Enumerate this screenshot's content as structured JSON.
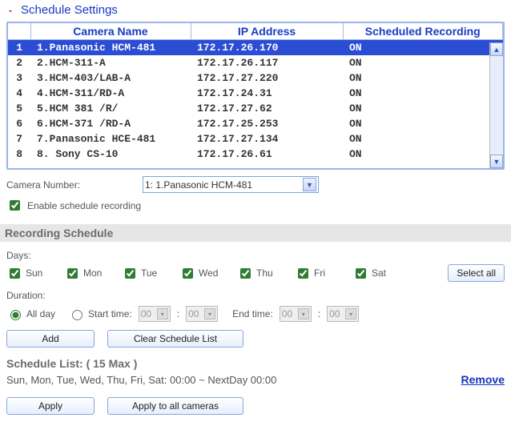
{
  "page": {
    "title": "Schedule Settings",
    "toggle_icon": "-"
  },
  "table": {
    "headers": {
      "index": "",
      "name": "Camera Name",
      "ip": "IP Address",
      "rec": "Scheduled Recording"
    },
    "rows": [
      {
        "idx": "1",
        "name": "1.Panasonic HCM-481",
        "ip": "172.17.26.170",
        "rec": "ON",
        "selected": true
      },
      {
        "idx": "2",
        "name": "2.HCM-311-A",
        "ip": "172.17.26.117",
        "rec": "ON",
        "selected": false
      },
      {
        "idx": "3",
        "name": "3.HCM-403/LAB-A",
        "ip": "172.17.27.220",
        "rec": "ON",
        "selected": false
      },
      {
        "idx": "4",
        "name": "4.HCM-311/RD-A",
        "ip": "172.17.24.31",
        "rec": "ON",
        "selected": false
      },
      {
        "idx": "5",
        "name": "5.HCM 381 /R/",
        "ip": "172.17.27.62",
        "rec": "ON",
        "selected": false
      },
      {
        "idx": "6",
        "name": "6.HCM-371 /RD-A",
        "ip": "172.17.25.253",
        "rec": "ON",
        "selected": false
      },
      {
        "idx": "7",
        "name": "7.Panasonic HCE-481",
        "ip": "172.17.27.134",
        "rec": "ON",
        "selected": false
      },
      {
        "idx": "8",
        "name": "8. Sony CS-10",
        "ip": "172.17.26.61",
        "rec": "ON",
        "selected": false
      }
    ]
  },
  "camera_number": {
    "label": "Camera Number:",
    "value": "1: 1.Panasonic HCM-481"
  },
  "enable_recording": {
    "label": "Enable schedule recording",
    "checked": true
  },
  "recording_schedule": {
    "title": "Recording Schedule",
    "days_label": "Days:",
    "days": [
      {
        "key": "sun",
        "label": "Sun",
        "checked": true
      },
      {
        "key": "mon",
        "label": "Mon",
        "checked": true
      },
      {
        "key": "tue",
        "label": "Tue",
        "checked": true
      },
      {
        "key": "wed",
        "label": "Wed",
        "checked": true
      },
      {
        "key": "thu",
        "label": "Thu",
        "checked": true
      },
      {
        "key": "fri",
        "label": "Fri",
        "checked": true
      },
      {
        "key": "sat",
        "label": "Sat",
        "checked": true
      }
    ],
    "select_all": "Select all",
    "duration_label": "Duration:",
    "duration_mode": "all_day",
    "all_day_label": "All day",
    "start_time_label": "Start time:",
    "end_time_label": "End time:",
    "time_parts": {
      "start_h": "00",
      "start_m": "00",
      "end_h": "00",
      "end_m": "00",
      "sep": ":"
    },
    "add_btn": "Add",
    "clear_btn": "Clear Schedule List"
  },
  "schedule_list": {
    "title": "Schedule List: ( 15 Max )",
    "entry": "Sun, Mon, Tue, Wed, Thu, Fri, Sat: 00:00 ~ NextDay 00:00",
    "remove": "Remove"
  },
  "actions": {
    "apply": "Apply",
    "apply_all": "Apply to all cameras"
  }
}
